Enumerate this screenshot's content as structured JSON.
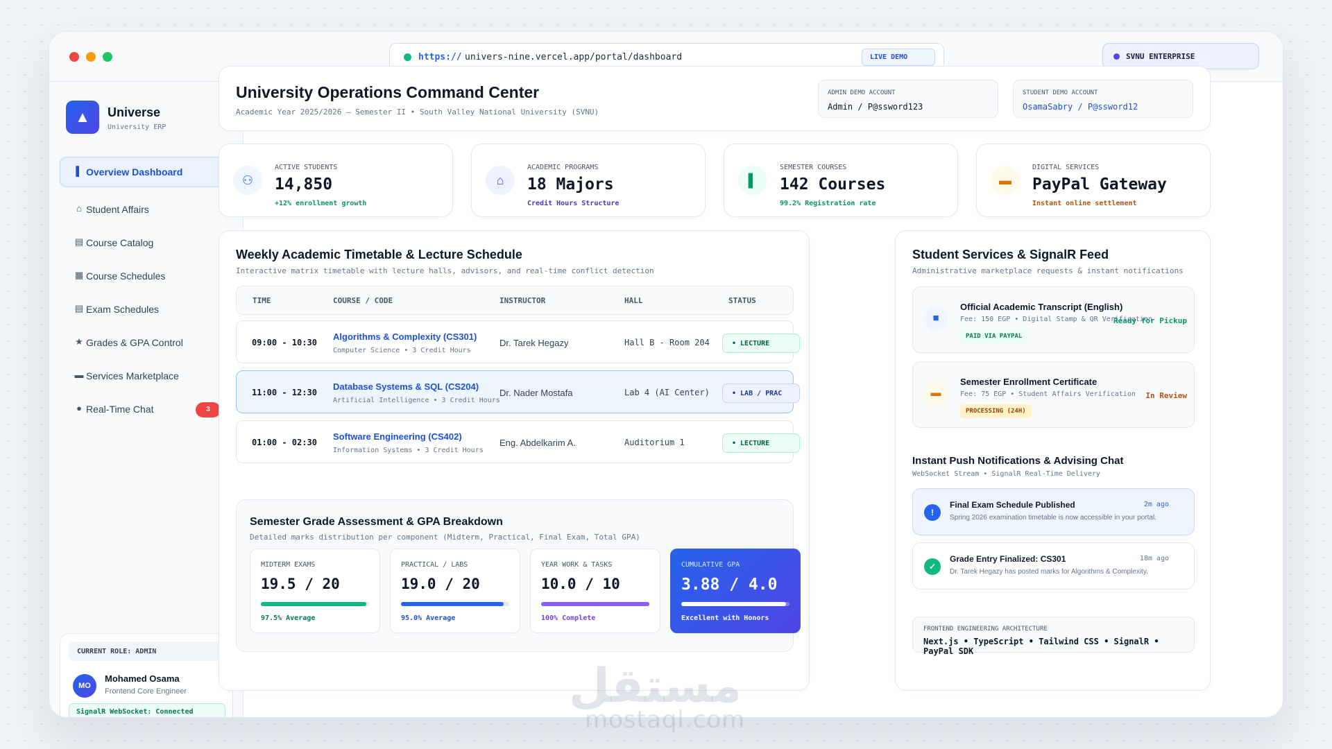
{
  "browser": {
    "url_scheme": "https://",
    "url_path": "univers-nine.vercel.app/portal/dashboard",
    "live_badge": "LIVE DEMO",
    "enterprise_badge": "SVNU ENTERPRISE"
  },
  "sidebar": {
    "brand_name": "Universe",
    "brand_sub": "University ERP",
    "items": [
      {
        "label": "Overview Dashboard",
        "icon": "chart-bars-icon",
        "glyph": "▌"
      },
      {
        "label": "Student Affairs",
        "icon": "building-icon",
        "glyph": "⌂"
      },
      {
        "label": "Course Catalog",
        "icon": "books-icon",
        "glyph": "▤"
      },
      {
        "label": "Course Schedules",
        "icon": "calendar-icon",
        "glyph": "▦"
      },
      {
        "label": "Exam Schedules",
        "icon": "table-icon",
        "glyph": "▤"
      },
      {
        "label": "Grades & GPA Control",
        "icon": "trophy-icon",
        "glyph": "★"
      },
      {
        "label": "Services Marketplace",
        "icon": "card-icon",
        "glyph": "▬"
      },
      {
        "label": "Real-Time Chat",
        "icon": "chat-icon",
        "glyph": "●",
        "badge": "3"
      }
    ],
    "role_label": "CURRENT ROLE: ADMIN",
    "user_initials": "MO",
    "user_name": "Mohamed Osama",
    "user_role": "Frontend Core Engineer",
    "connection": "SignalR WebSocket: Connected"
  },
  "header": {
    "title": "University Operations Command Center",
    "subtitle": "Academic Year 2025/2026 — Semester II • South Valley National University (SVNU)",
    "admin_label": "ADMIN DEMO ACCOUNT",
    "admin_value": "Admin / P@ssword123",
    "student_label": "STUDENT DEMO ACCOUNT",
    "student_value": "OsamaSabry / P@ssword12"
  },
  "stats": [
    {
      "label": "ACTIVE STUDENTS",
      "value": "14,850",
      "note": "+12% enrollment growth",
      "icon": "students-icon",
      "glyph": "⚇",
      "color": "#2563eb",
      "bg": "#eff6ff",
      "note_color": "#059669"
    },
    {
      "label": "ACADEMIC PROGRAMS",
      "value": "18 Majors",
      "note": "Credit Hours Structure",
      "icon": "institution-icon",
      "glyph": "⌂",
      "color": "#4f46e5",
      "bg": "#eef2ff",
      "note_color": "#4338ca"
    },
    {
      "label": "SEMESTER COURSES",
      "value": "142 Courses",
      "note": "99.2% Registration rate",
      "icon": "chart-icon",
      "glyph": "▌",
      "color": "#059669",
      "bg": "#ecfdf5",
      "note_color": "#059669"
    },
    {
      "label": "DIGITAL SERVICES",
      "value": "PayPal Gateway",
      "note": "Instant online settlement",
      "icon": "card-icon",
      "glyph": "▬",
      "color": "#d97706",
      "bg": "#fffbeb",
      "note_color": "#b45309"
    }
  ],
  "timetable": {
    "title": "Weekly Academic Timetable & Lecture Schedule",
    "subtitle": "Interactive matrix timetable with lecture halls, advisors, and real-time conflict detection",
    "columns": [
      "TIME",
      "COURSE / CODE",
      "INSTRUCTOR",
      "HALL",
      "STATUS"
    ],
    "rows": [
      {
        "time": "09:00 - 10:30",
        "course": "Algorithms & Complexity (CS301)",
        "dept": "Computer Science • 3 Credit Hours",
        "instructor": "Dr. Tarek Hegazy",
        "hall": "Hall B - Room 204",
        "status": "• LECTURE"
      },
      {
        "time": "11:00 - 12:30",
        "course": "Database Systems & SQL (CS204)",
        "dept": "Artificial Intelligence • 3 Credit Hours",
        "instructor": "Dr. Nader Mostafa",
        "hall": "Lab 4 (AI Center)",
        "status": "• LAB / PRAC"
      },
      {
        "time": "01:00 - 02:30",
        "course": "Software Engineering (CS402)",
        "dept": "Information Systems • 3 Credit Hours",
        "instructor": "Eng. Abdelkarim A.",
        "hall": "Auditorium 1",
        "status": "• LECTURE"
      }
    ]
  },
  "grades": {
    "title": "Semester Grade Assessment & GPA Breakdown",
    "subtitle": "Detailed marks distribution per component (Midterm, Practical, Final Exam, Total GPA)",
    "cards": [
      {
        "label": "MIDTERM EXAMS",
        "value": "19.5 / 20",
        "note": "97.5% Average",
        "progress": 0.975,
        "color": "#10b981",
        "note_color": "#047857"
      },
      {
        "label": "PRACTICAL / LABS",
        "value": "19.0 / 20",
        "note": "95.0% Average",
        "progress": 0.95,
        "color": "#2563eb",
        "note_color": "#1d4ed8"
      },
      {
        "label": "YEAR WORK & TASKS",
        "value": "10.0 / 10",
        "note": "100% Complete",
        "progress": 1.0,
        "color": "#8b5cf6",
        "note_color": "#7c3aed"
      },
      {
        "label": "CUMULATIVE GPA",
        "value": "3.88 / 4.0",
        "note": "Excellent with Honors",
        "progress": 0.97,
        "color": "#ffffff",
        "note_color": "#ffffff"
      }
    ]
  },
  "services": {
    "title": "Student Services & SignalR Feed",
    "subtitle": "Administrative marketplace requests & instant notifications",
    "items": [
      {
        "title": "Official Academic Transcript (English)",
        "fee": "Fee: 150 EGP • Digital Stamp & QR Verification",
        "tag": "PAID VIA PAYPAL",
        "status": "Ready for Pickup",
        "icon": "document-icon",
        "glyph": "■",
        "icon_color": "#2563eb",
        "icon_bg": "#eff6ff",
        "tag_bg": "#ecfdf5",
        "tag_color": "#047857",
        "status_color": "#059669"
      },
      {
        "title": "Semester Enrollment Certificate",
        "fee": "Fee: 75 EGP • Student Affairs Verification",
        "tag": "PROCESSING (24H)",
        "status": "In Review",
        "icon": "certificate-icon",
        "glyph": "▬",
        "icon_color": "#d97706",
        "icon_bg": "#fffbeb",
        "tag_bg": "#fef3c7",
        "tag_color": "#92400e",
        "status_color": "#b45309"
      }
    ]
  },
  "notifications": {
    "title": "Instant Push Notifications & Advising Chat",
    "subtitle": "WebSocket Stream • SignalR Real-Time Delivery",
    "items": [
      {
        "title": "Final Exam Schedule Published",
        "body": "Spring 2026 examination timetable is now accessible in your portal.",
        "time": "2m ago",
        "icon": "alert-icon",
        "glyph": "!",
        "icon_bg": "#2563eb",
        "time_color": "#2563eb"
      },
      {
        "title": "Grade Entry Finalized: CS301",
        "body": "Dr. Tarek Hegazy has posted marks for Algorithms & Complexity.",
        "time": "18m ago",
        "icon": "check-icon",
        "glyph": "✓",
        "icon_bg": "#10b981",
        "time_color": "#64748b"
      }
    ]
  },
  "architecture": {
    "label": "FRONTEND ENGINEERING ARCHITECTURE",
    "value": "Next.js • TypeScript • Tailwind CSS • SignalR • PayPal SDK"
  },
  "watermark": {
    "arabic": "مستقل",
    "latin": "mostaql.com"
  }
}
